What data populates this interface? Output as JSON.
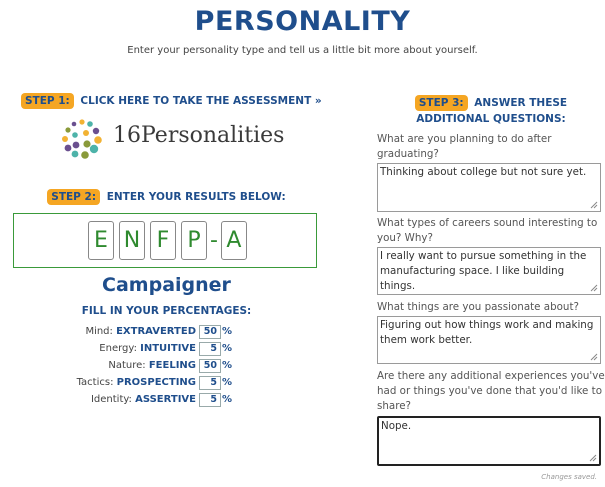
{
  "header": {
    "title": "PERSONALITY",
    "subtitle": "Enter your personality type and tell us a little bit more about yourself."
  },
  "step1": {
    "badge": "STEP 1:",
    "link_text": "CLICK HERE TO TAKE THE ASSESSMENT »"
  },
  "logo": {
    "text": "16Personalities"
  },
  "step2": {
    "badge": "STEP 2:",
    "label": "ENTER YOUR RESULTS BELOW:",
    "letters": [
      "E",
      "N",
      "F",
      "P",
      "A"
    ],
    "dash": "-",
    "type_name": "Campaigner"
  },
  "percentages": {
    "heading": "FILL IN YOUR PERCENTAGES:",
    "rows": [
      {
        "label": "Mind:",
        "trait": "EXTRAVERTED",
        "value": "50",
        "unit": "%"
      },
      {
        "label": "Energy:",
        "trait": "INTUITIVE",
        "value": "5",
        "unit": "%"
      },
      {
        "label": "Nature:",
        "trait": "FEELING",
        "value": "50",
        "unit": "%"
      },
      {
        "label": "Tactics:",
        "trait": "PROSPECTING",
        "value": "5",
        "unit": "%"
      },
      {
        "label": "Identity:",
        "trait": "ASSERTIVE",
        "value": "5",
        "unit": "%"
      }
    ]
  },
  "step3": {
    "badge": "STEP 3:",
    "label_line1": "ANSWER THESE",
    "label_line2": "ADDITIONAL QUESTIONS:",
    "questions": [
      {
        "question": "What are you planning to do after graduating?",
        "answer": "Thinking about college but not sure yet."
      },
      {
        "question": "What types of careers sound interesting to you? Why?",
        "answer": "I really want to pursue something in the manufacturing space. I like building things."
      },
      {
        "question": "What things are you passionate about?",
        "answer": "Figuring out how things work and making them work better."
      },
      {
        "question": "Are there any additional experiences you've had or things you've done that you'd like to share?",
        "answer": "Nope."
      }
    ]
  },
  "status": {
    "saved": "Changes saved."
  },
  "colors": {
    "brand": "#1f4e8c",
    "step_badge": "#f5a623",
    "type_green": "#2f8a2f"
  }
}
